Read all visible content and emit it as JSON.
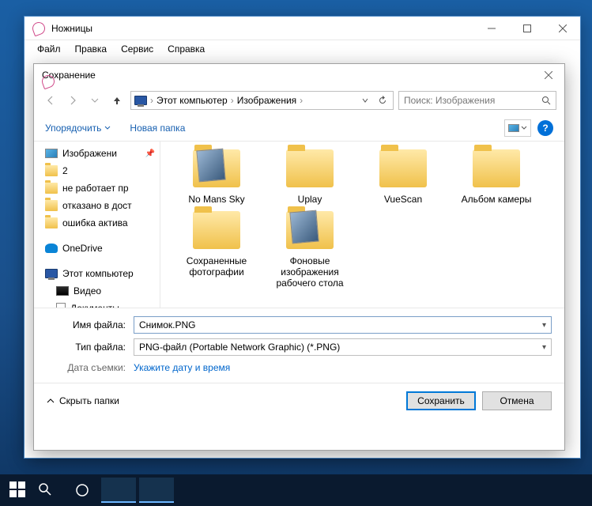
{
  "parent": {
    "title": "Ножницы",
    "menu": [
      "Файл",
      "Правка",
      "Сервис",
      "Справка"
    ]
  },
  "save": {
    "title": "Сохранение",
    "breadcrumbs": [
      "Этот компьютер",
      "Изображения"
    ],
    "search_placeholder": "Поиск: Изображения",
    "toolbar": {
      "organize": "Упорядочить",
      "new_folder": "Новая папка"
    },
    "tree": {
      "pictures": "Изображени",
      "items": [
        "2",
        "не работает пр",
        "отказано в дост",
        "ошибка актива"
      ],
      "onedrive": "OneDrive",
      "thispc": "Этот компьютер",
      "video": "Видео",
      "docs": "Документы"
    },
    "files": [
      {
        "label": "No Mans Sky",
        "preview": true
      },
      {
        "label": "Uplay",
        "preview": false
      },
      {
        "label": "VueScan",
        "preview": false
      },
      {
        "label": "Альбом камеры",
        "preview": false
      },
      {
        "label": "Сохраненные фотографии",
        "preview": false
      },
      {
        "label": "Фоновые изображения рабочего стола",
        "preview": true
      }
    ],
    "form": {
      "name_label": "Имя файла:",
      "name_value": "Снимок.PNG",
      "type_label": "Тип файла:",
      "type_value": "PNG-файл (Portable Network Graphic) (*.PNG)",
      "date_label": "Дата съемки:",
      "date_link": "Укажите дату и время"
    },
    "footer": {
      "hide": "Скрыть папки",
      "save": "Сохранить",
      "cancel": "Отмена"
    }
  }
}
